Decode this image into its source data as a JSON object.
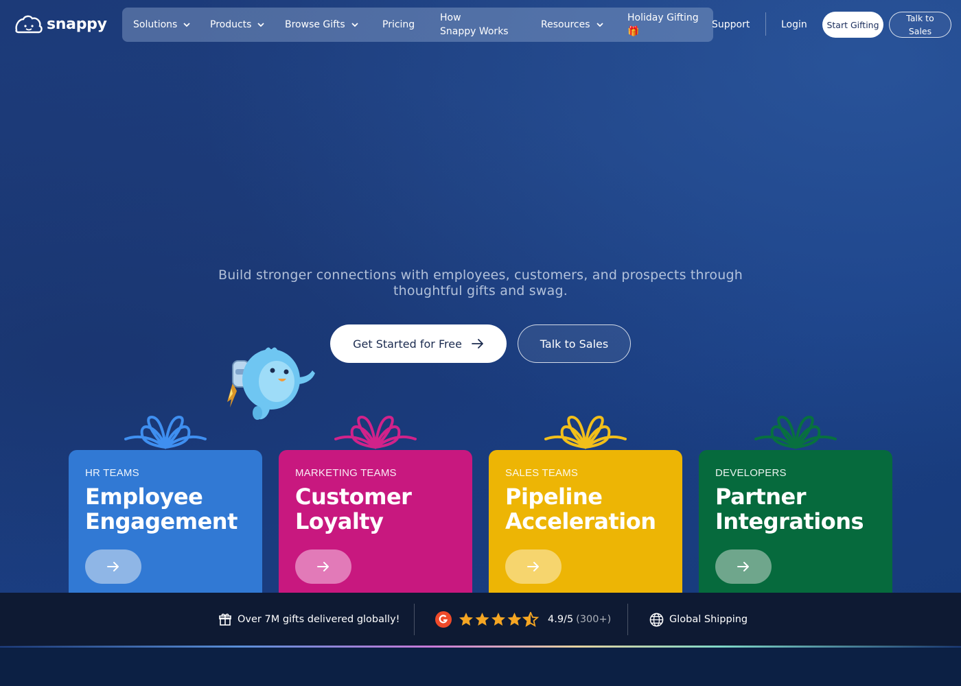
{
  "brand": {
    "name": "snappy"
  },
  "nav": {
    "items": [
      {
        "label": "Solutions",
        "dropdown": true
      },
      {
        "label": "Products",
        "dropdown": true
      },
      {
        "label": "Browse Gifts",
        "dropdown": true
      },
      {
        "label": "Pricing",
        "dropdown": false
      },
      {
        "label_line1": "How",
        "label_line2": "Snappy Works",
        "dropdown": false
      },
      {
        "label": "Resources",
        "dropdown": true
      },
      {
        "label": "Holiday Gifting",
        "emoji": "🎁",
        "dropdown": false
      }
    ],
    "support": "Support",
    "login": "Login",
    "start_gifting": "Start Gifting",
    "talk_to_sales": "Talk to Sales"
  },
  "hero": {
    "subtitle": "Build stronger connections with employees, customers, and prospects through thoughtful gifts and swag.",
    "cta_primary": "Get Started for Free",
    "cta_secondary": "Talk to Sales"
  },
  "cards": [
    {
      "team": "HR TEAMS",
      "title_line1": "Employee",
      "title_line2": "Engagement",
      "color": "#3179d4",
      "bow_color": "#3f8ff0"
    },
    {
      "team": "MARKETING TEAMS",
      "title_line1": "Customer",
      "title_line2": "Loyalty",
      "color": "#c8187f",
      "bow_color": "#d1228a"
    },
    {
      "team": "SALES TEAMS",
      "title_line1": "Pipeline",
      "title_line2": "Acceleration",
      "color": "#edb505",
      "bow_color": "#f2bf1a"
    },
    {
      "team": "DEVELOPERS",
      "title_line1": "Partner",
      "title_line2": "Integrations",
      "color": "#066a3d",
      "bow_color": "#08703f"
    }
  ],
  "stats": {
    "gifts_delivered": "Over 7M gifts delivered globally!",
    "rating_value": "4.9/5",
    "rating_count": "(300+)",
    "rating_stars": 4.5,
    "shipping": "Global Shipping"
  }
}
